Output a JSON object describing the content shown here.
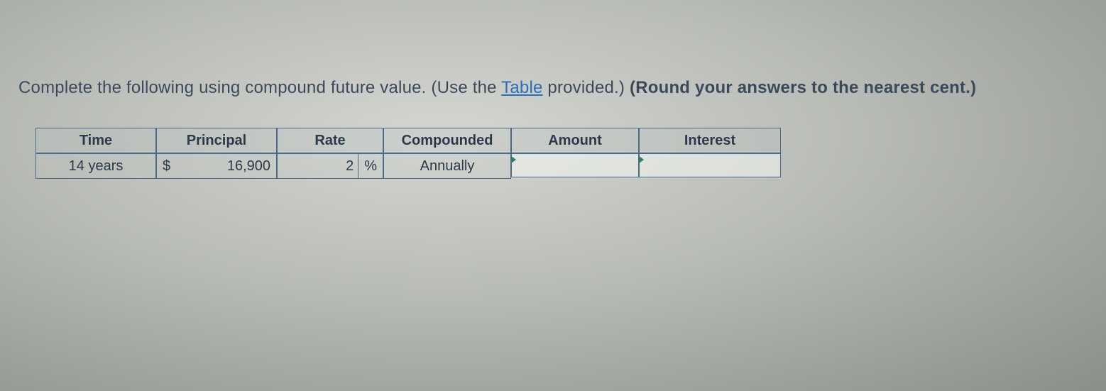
{
  "prompt": {
    "text_before": "Complete the following using compound future value. (Use the ",
    "link_text": "Table",
    "text_mid": " provided.) ",
    "bold_text": "(Round your answers to the nearest cent.)"
  },
  "table": {
    "headers": {
      "time": "Time",
      "principal": "Principal",
      "rate": "Rate",
      "compounded": "Compounded",
      "amount": "Amount",
      "interest": "Interest"
    },
    "row": {
      "time": "14 years",
      "principal_currency": "$",
      "principal_value": "16,900",
      "rate_value": "2",
      "rate_unit": "%",
      "compounded": "Annually",
      "amount": "",
      "interest": ""
    }
  }
}
